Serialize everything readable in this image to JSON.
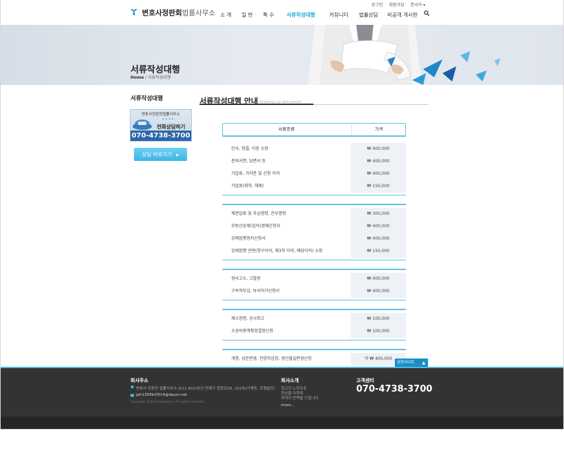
{
  "util": {
    "login": "로그인",
    "join": "회원가입",
    "lang": "한국어"
  },
  "header": {
    "logo_bold": "변호사정판회",
    "logo_light": "법률사무소"
  },
  "nav": [
    "소 개",
    "일 반",
    "특 수",
    "서류작성대행",
    "커뮤니티",
    "법률상담",
    "비공개 게시판"
  ],
  "banner": {
    "title": "서류작성대행",
    "crumb_home": "Home",
    "crumb_sep": "/",
    "crumb_current": "서류작성대행"
  },
  "sidebar": {
    "title": "서류작성대행",
    "promo_top": "변호사정판회법률사무소",
    "promo_dots": "• • • •",
    "promo_call": "전화상담하기",
    "promo_phone": "070-4738-3700",
    "button": "상담 바로가기",
    "button_arrow": "▶"
  },
  "main": {
    "title": "서류작성대행 안내",
    "subtitle": "drawing up document"
  },
  "table": {
    "headers": [
      "서류종류",
      "가격"
    ],
    "groups": [
      [
        {
          "item": "인사, 형결, 이혼 소장",
          "price": "₩ 400,000"
        },
        {
          "item": "준비서면, 답변서 등",
          "price": "₩ 400,000"
        },
        {
          "item": "가압류, 가처분 및 신청 이의",
          "price": "₩ 400,000"
        },
        {
          "item": "가압류(취하, 해제)",
          "price": "₩ 150,000"
        }
      ],
      [
        {
          "item": "채권압류 및 추심명령, 전부명령",
          "price": "₩ 300,000"
        },
        {
          "item": "부동산강제(임의)경매신청서",
          "price": "₩ 400,000"
        },
        {
          "item": "강제집행정지신청서",
          "price": "₩ 400,000"
        },
        {
          "item": "강제집행 관련(청구이의, 제3자 이의, 배당이의) 소장",
          "price": "₩ 150,000"
        }
      ],
      [
        {
          "item": "형사고소, 고발장",
          "price": "₩ 400,000"
        },
        {
          "item": "구속적부심, 보석허가신청서",
          "price": "₩ 400,000"
        }
      ],
      [
        {
          "item": "제소명령, 공시최고",
          "price": "₩ 100,000"
        },
        {
          "item": "소송비용액확정결정신청",
          "price": "₩ 100,000"
        }
      ],
      [
        {
          "item": "개명, 성본변경, 친양자입양, 생년월일변경신청",
          "price": "각 ₩ 400,000"
        }
      ]
    ]
  },
  "footer": {
    "related": "관련사이트",
    "related_caret": "▲",
    "address_title": "회사주소",
    "address": "변호사 정판회 법률사무소 (611-803)부산 연제구 법원로38, 202호(거제동, 로펌빌딩)",
    "email": "jph1359kr0514@daum.net",
    "copyright": "Copyright 2015 Redylawyer. All rights reserved.",
    "intro_title": "회사소개",
    "intro_lines": [
      "최고의 노하우로",
      "최선을 다하며",
      "최대의 만족을 드립니다"
    ],
    "more": "more...",
    "center_title": "고객센터",
    "center_phone": "070-4738-3700"
  },
  "colors": {
    "accent": "#1aa7d9",
    "table_border": "#5fc3e7",
    "footer_bg": "#333333",
    "promo_blue": "#2d66a8"
  }
}
